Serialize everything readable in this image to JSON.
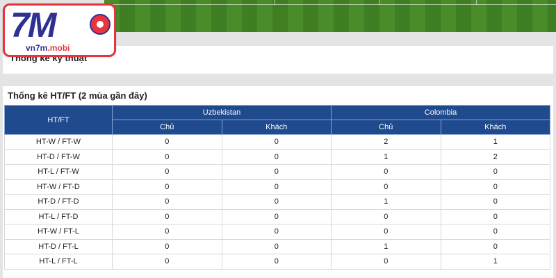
{
  "logo": {
    "mark": "7M",
    "domain_main": "vn7m",
    "domain_suffix": ".mobi",
    "colors": {
      "primary": "#2e3192",
      "accent": "#e8343c"
    }
  },
  "top_section": {
    "title": "Thống kê kỹ thuật"
  },
  "ht_ft_section": {
    "title": "Thống kê HT/FT (2 mùa gần đây)",
    "row_header": "HT/FT",
    "teams": [
      {
        "name": "Uzbekistan",
        "columns": [
          "Chủ",
          "Khách"
        ]
      },
      {
        "name": "Colombia",
        "columns": [
          "Chủ",
          "Khách"
        ]
      }
    ],
    "rows": [
      {
        "label": "HT-W / FT-W",
        "values": [
          "0",
          "0",
          "2",
          "1"
        ]
      },
      {
        "label": "HT-D / FT-W",
        "values": [
          "0",
          "0",
          "1",
          "2"
        ]
      },
      {
        "label": "HT-L / FT-W",
        "values": [
          "0",
          "0",
          "0",
          "0"
        ]
      },
      {
        "label": "HT-W / FT-D",
        "values": [
          "0",
          "0",
          "0",
          "0"
        ]
      },
      {
        "label": "HT-D / FT-D",
        "values": [
          "0",
          "0",
          "1",
          "0"
        ]
      },
      {
        "label": "HT-L / FT-D",
        "values": [
          "0",
          "0",
          "0",
          "0"
        ]
      },
      {
        "label": "HT-W / FT-L",
        "values": [
          "0",
          "0",
          "0",
          "0"
        ]
      },
      {
        "label": "HT-D / FT-L",
        "values": [
          "0",
          "0",
          "1",
          "0"
        ]
      },
      {
        "label": "HT-L / FT-L",
        "values": [
          "0",
          "0",
          "0",
          "1"
        ]
      }
    ],
    "colors": {
      "header_bg": "#1f4a8e",
      "header_text": "#ffffff"
    }
  }
}
